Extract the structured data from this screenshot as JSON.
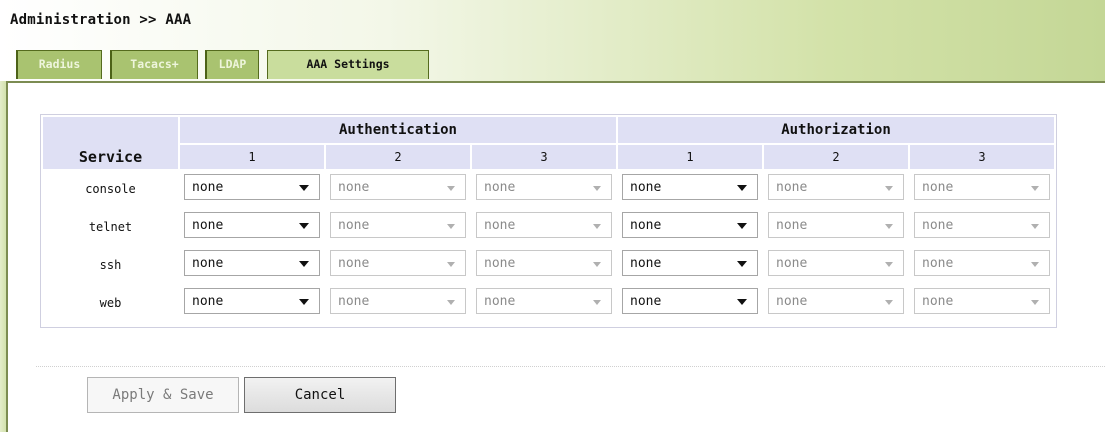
{
  "breadcrumb": "Administration >> AAA",
  "tabs": [
    {
      "label": "Radius",
      "active": false
    },
    {
      "label": "Tacacs+",
      "active": false
    },
    {
      "label": "LDAP",
      "active": false
    },
    {
      "label": "AAA Settings",
      "active": true
    }
  ],
  "table": {
    "service_header": "Service",
    "groups": [
      "Authentication",
      "Authorization"
    ],
    "sub_columns": [
      "1",
      "2",
      "3"
    ],
    "rows": [
      {
        "service": "console",
        "auth": [
          "none",
          "none",
          "none"
        ],
        "authz": [
          "none",
          "none",
          "none"
        ]
      },
      {
        "service": "telnet",
        "auth": [
          "none",
          "none",
          "none"
        ],
        "authz": [
          "none",
          "none",
          "none"
        ]
      },
      {
        "service": "ssh",
        "auth": [
          "none",
          "none",
          "none"
        ],
        "authz": [
          "none",
          "none",
          "none"
        ]
      },
      {
        "service": "web",
        "auth": [
          "none",
          "none",
          "none"
        ],
        "authz": [
          "none",
          "none",
          "none"
        ]
      }
    ]
  },
  "buttons": {
    "apply": "Apply & Save",
    "cancel": "Cancel"
  },
  "colors": {
    "tab_active": "#c9dd9d",
    "tab_inactive": "#a9c370",
    "header_cell": "#dfe0f4"
  },
  "icons": {
    "dropdown": "chevron-down-icon"
  }
}
